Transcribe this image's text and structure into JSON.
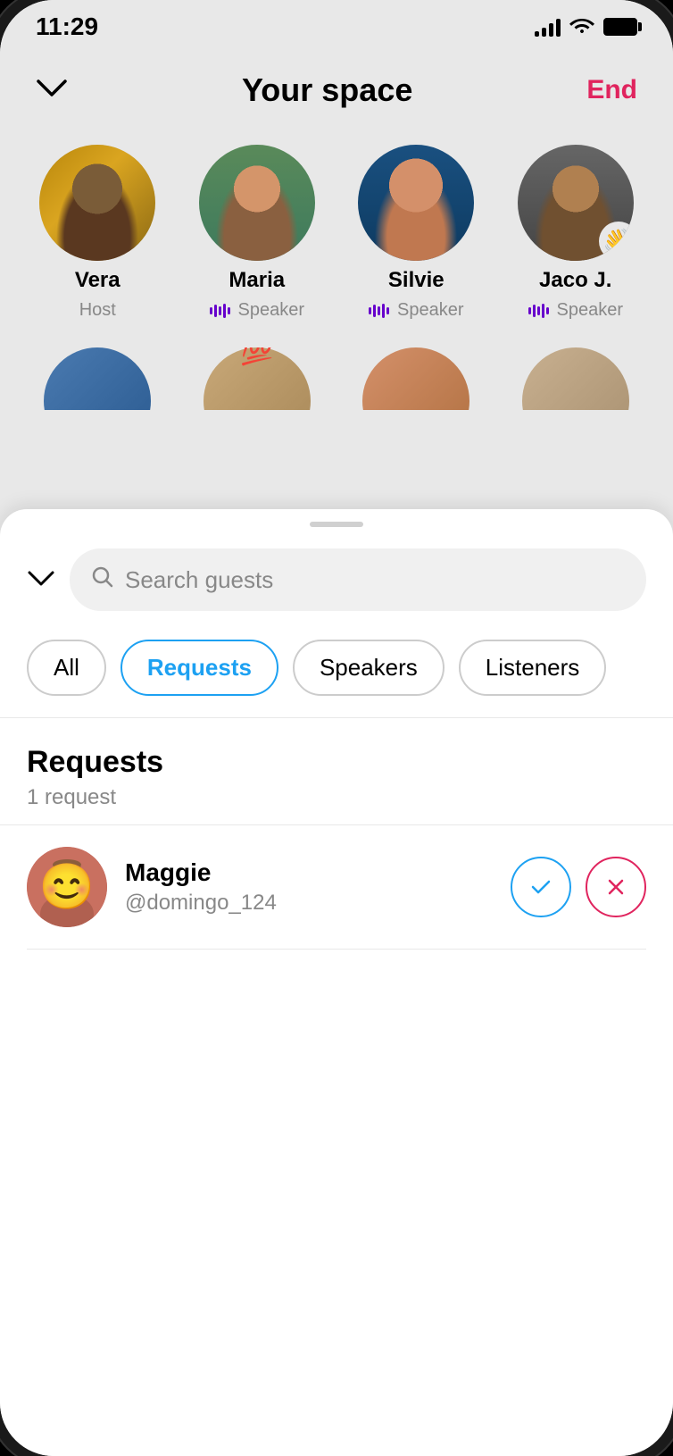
{
  "status_bar": {
    "time": "11:29"
  },
  "header": {
    "title": "Your space",
    "end_label": "End",
    "chevron_label": "‹"
  },
  "speakers": [
    {
      "name": "Vera",
      "role": "Host",
      "has_wave": false,
      "avatar_class": "avatar-img-vera"
    },
    {
      "name": "Maria",
      "role": "Speaker",
      "has_wave": false,
      "avatar_class": "avatar-img-maria"
    },
    {
      "name": "Silvie",
      "role": "Speaker",
      "has_wave": false,
      "avatar_class": "avatar-img-silvie"
    },
    {
      "name": "Jaco J.",
      "role": "Speaker",
      "has_wave": true,
      "avatar_class": "avatar-img-jaco"
    }
  ],
  "bottom_sheet": {
    "search_placeholder": "Search guests",
    "tabs": [
      {
        "label": "All",
        "active": false
      },
      {
        "label": "Requests",
        "active": true
      },
      {
        "label": "Speakers",
        "active": false
      },
      {
        "label": "Listeners",
        "active": false
      }
    ],
    "requests_section": {
      "title": "Requests",
      "count_label": "1 request"
    },
    "requests": [
      {
        "name": "Maggie",
        "handle": "@domingo_124"
      }
    ]
  },
  "icons": {
    "checkmark": "✓",
    "cross": "✕",
    "chevron_down": "⌄",
    "search": "⌕",
    "wave": "👋"
  }
}
